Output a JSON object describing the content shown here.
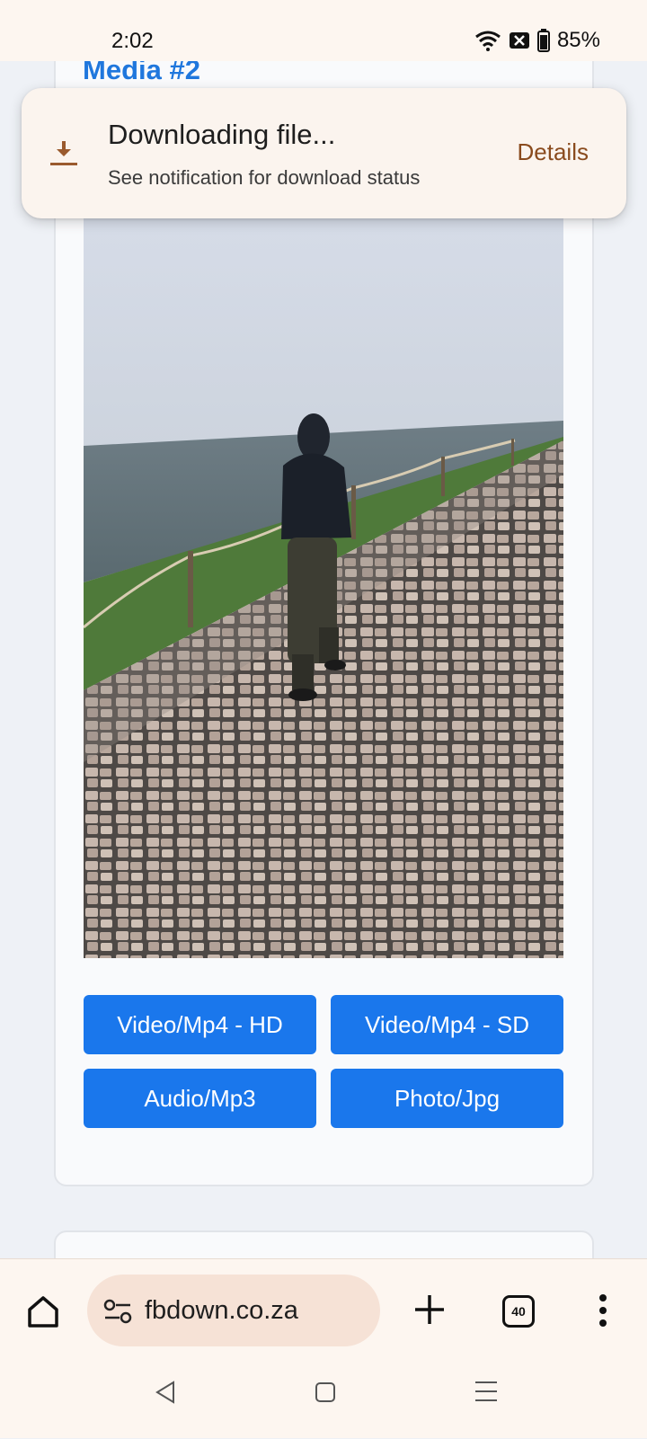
{
  "status_bar": {
    "time": "2:02",
    "battery": "85%",
    "icons": [
      "wifi-icon",
      "notification-x-icon",
      "battery-icon"
    ]
  },
  "toast": {
    "icon": "download-icon",
    "title": "Downloading file...",
    "subtitle": "See notification for download status",
    "action_label": "Details"
  },
  "media": {
    "title": "Media #2",
    "buttons": [
      {
        "label": "Video/Mp4 - HD"
      },
      {
        "label": "Video/Mp4 - SD"
      },
      {
        "label": "Audio/Mp3"
      },
      {
        "label": "Photo/Jpg"
      }
    ]
  },
  "browser_bar": {
    "url": "fbdown.co.za",
    "tab_count": "40",
    "icons": [
      "home-icon",
      "site-settings-icon",
      "new-tab-plus-icon",
      "tab-switcher-icon",
      "more-menu-icon"
    ]
  },
  "nav_bar": {
    "icons": [
      "back-icon",
      "home-square-icon",
      "recents-menu-icon"
    ]
  },
  "colors": {
    "accent": "#1a77ec",
    "title_blue": "#1f77dd",
    "toast_action": "#8a4b1e",
    "chrome_bg": "#fdf6f0",
    "url_pill_bg": "#f6e2d6"
  }
}
